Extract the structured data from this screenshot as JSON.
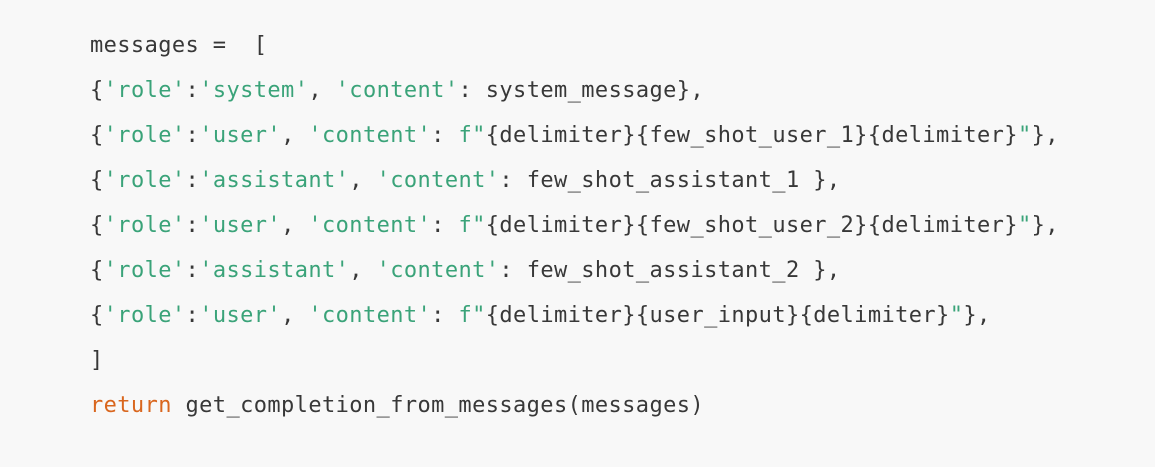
{
  "code_block": {
    "lines": [
      [
        {
          "text": "messages =  [",
          "type": "text"
        }
      ],
      [
        {
          "text": "{",
          "type": "text"
        },
        {
          "text": "'role'",
          "type": "str"
        },
        {
          "text": ":",
          "type": "text"
        },
        {
          "text": "'system'",
          "type": "str"
        },
        {
          "text": ", ",
          "type": "text"
        },
        {
          "text": "'content'",
          "type": "str"
        },
        {
          "text": ": system_message},",
          "type": "text"
        }
      ],
      [
        {
          "text": "{",
          "type": "text"
        },
        {
          "text": "'role'",
          "type": "str"
        },
        {
          "text": ":",
          "type": "text"
        },
        {
          "text": "'user'",
          "type": "str"
        },
        {
          "text": ", ",
          "type": "text"
        },
        {
          "text": "'content'",
          "type": "str"
        },
        {
          "text": ": ",
          "type": "text"
        },
        {
          "text": "f\"",
          "type": "str"
        },
        {
          "text": "{delimiter}{few_shot_user_1}{delimiter}",
          "type": "text"
        },
        {
          "text": "\"",
          "type": "str"
        },
        {
          "text": "},",
          "type": "text"
        }
      ],
      [
        {
          "text": "{",
          "type": "text"
        },
        {
          "text": "'role'",
          "type": "str"
        },
        {
          "text": ":",
          "type": "text"
        },
        {
          "text": "'assistant'",
          "type": "str"
        },
        {
          "text": ", ",
          "type": "text"
        },
        {
          "text": "'content'",
          "type": "str"
        },
        {
          "text": ": few_shot_assistant_1 },",
          "type": "text"
        }
      ],
      [
        {
          "text": "{",
          "type": "text"
        },
        {
          "text": "'role'",
          "type": "str"
        },
        {
          "text": ":",
          "type": "text"
        },
        {
          "text": "'user'",
          "type": "str"
        },
        {
          "text": ", ",
          "type": "text"
        },
        {
          "text": "'content'",
          "type": "str"
        },
        {
          "text": ": ",
          "type": "text"
        },
        {
          "text": "f\"",
          "type": "str"
        },
        {
          "text": "{delimiter}{few_shot_user_2}{delimiter}",
          "type": "text"
        },
        {
          "text": "\"",
          "type": "str"
        },
        {
          "text": "},",
          "type": "text"
        }
      ],
      [
        {
          "text": "{",
          "type": "text"
        },
        {
          "text": "'role'",
          "type": "str"
        },
        {
          "text": ":",
          "type": "text"
        },
        {
          "text": "'assistant'",
          "type": "str"
        },
        {
          "text": ", ",
          "type": "text"
        },
        {
          "text": "'content'",
          "type": "str"
        },
        {
          "text": ": few_shot_assistant_2 },",
          "type": "text"
        }
      ],
      [
        {
          "text": "{",
          "type": "text"
        },
        {
          "text": "'role'",
          "type": "str"
        },
        {
          "text": ":",
          "type": "text"
        },
        {
          "text": "'user'",
          "type": "str"
        },
        {
          "text": ", ",
          "type": "text"
        },
        {
          "text": "'content'",
          "type": "str"
        },
        {
          "text": ": ",
          "type": "text"
        },
        {
          "text": "f\"",
          "type": "str"
        },
        {
          "text": "{delimiter}{user_input}{delimiter}",
          "type": "text"
        },
        {
          "text": "\"",
          "type": "str"
        },
        {
          "text": "},",
          "type": "text"
        }
      ],
      [
        {
          "text": "]",
          "type": "text"
        }
      ],
      [
        {
          "text": "return",
          "type": "kw"
        },
        {
          "text": " get_completion_from_messages(messages)",
          "type": "text"
        }
      ]
    ]
  },
  "theme": {
    "background": "#f8f8f8",
    "text_color": "#383838",
    "string_color": "#3aa379",
    "keyword_color": "#d9661e"
  }
}
